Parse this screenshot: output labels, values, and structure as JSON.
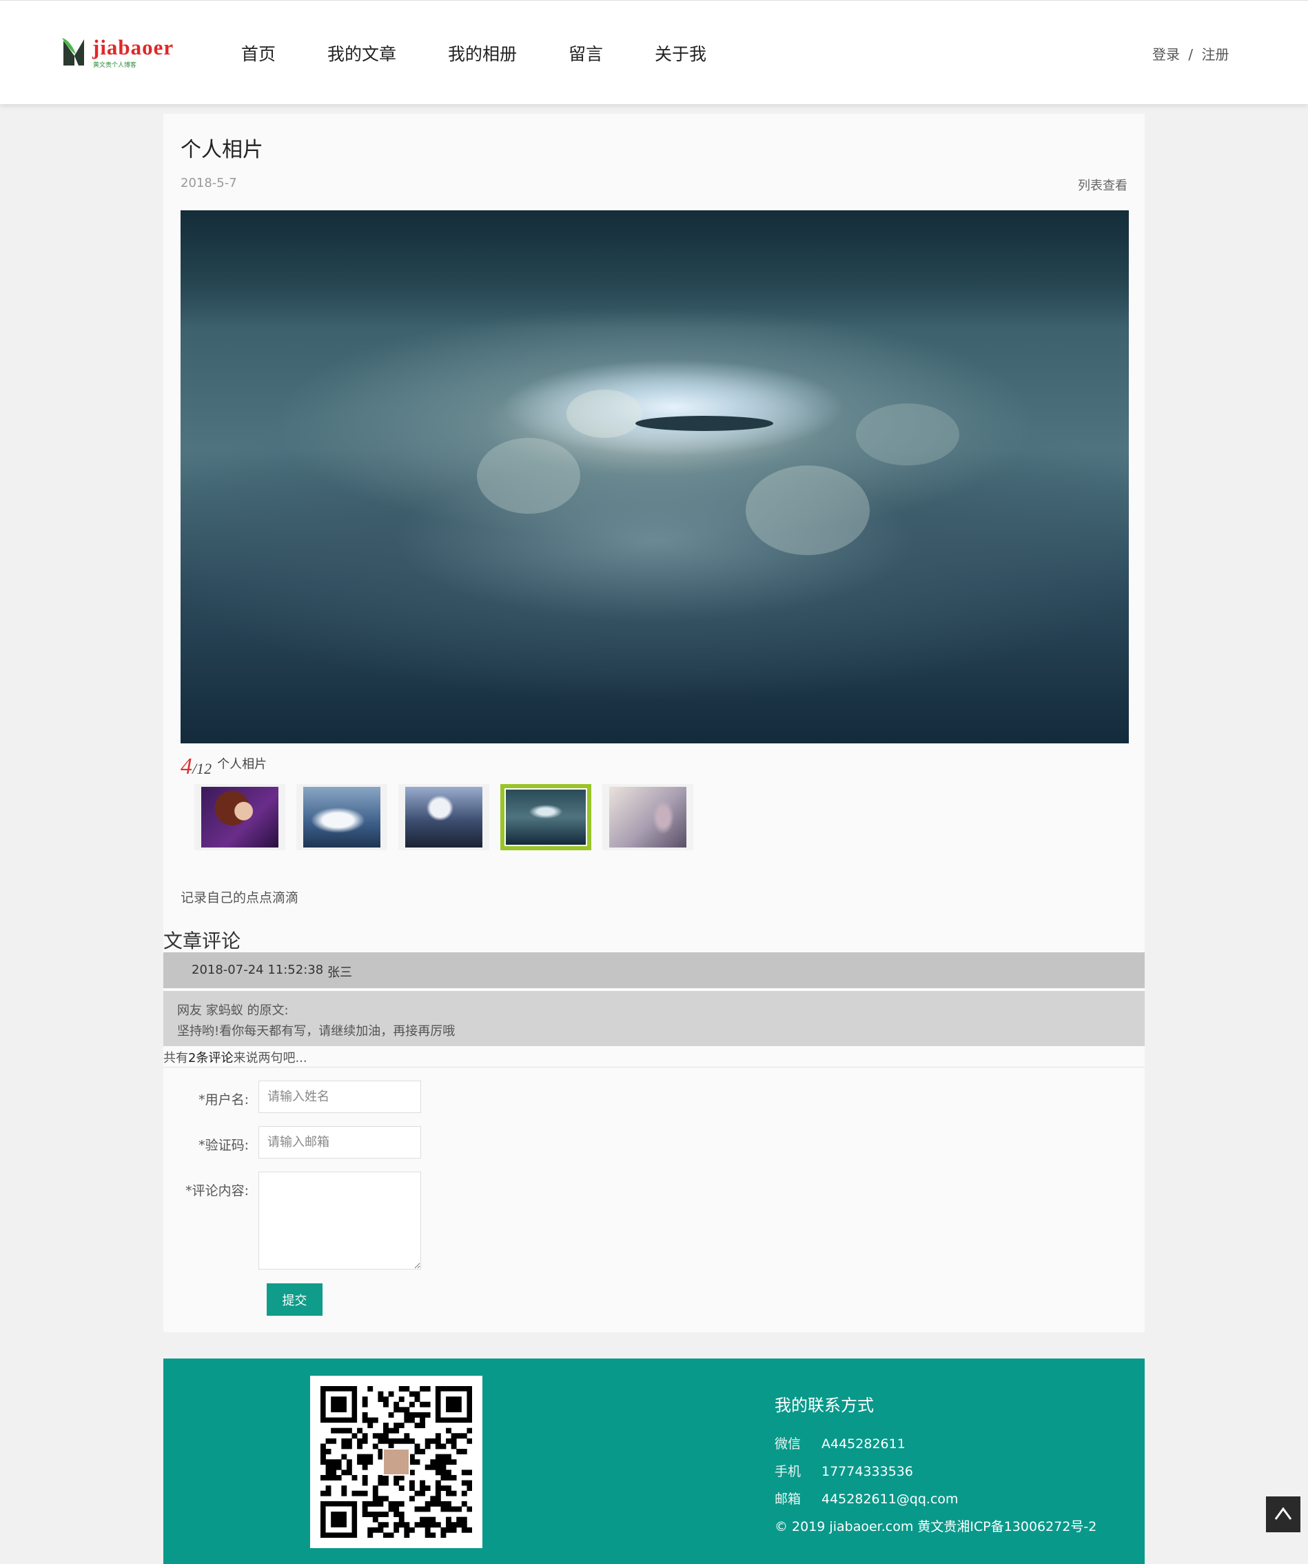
{
  "header": {
    "logo": {
      "brand": "jiabaoer",
      "tagline": "黄文贵个人博客"
    },
    "nav": [
      {
        "label": "首页",
        "icon": ""
      },
      {
        "label": "我的文章",
        "icon": ""
      },
      {
        "label": "我的相册",
        "icon": ""
      },
      {
        "label": "留言",
        "icon": ""
      },
      {
        "label": "关于我",
        "icon": ""
      }
    ],
    "auth": {
      "login": "登录",
      "sep": "/",
      "register": "注册"
    }
  },
  "album": {
    "title": "个人相片",
    "date": "2018-5-7",
    "list_view": "列表查看",
    "counter": {
      "current": "4",
      "total": "/12",
      "album_name": "个人相片"
    },
    "thumbnails": [
      {
        "name": "thumb-woman-purple",
        "active": false
      },
      {
        "name": "thumb-snow-peak",
        "active": false
      },
      {
        "name": "thumb-winged-horse",
        "active": false
      },
      {
        "name": "thumb-clouds",
        "active": true
      },
      {
        "name": "thumb-fantasy-girl",
        "active": false
      }
    ],
    "description": "记录自己的点点滴滴"
  },
  "comments": {
    "section_title": "文章评论",
    "items": [
      {
        "time": "2018-07-24 11:52:38",
        "author": "张三",
        "quote_line": "网友 家蚂蚁 的原文:",
        "content": "坚持哟!看你每天都有写，请继续加油，再接再厉哦"
      }
    ],
    "count_prefix": "共有",
    "count_value": "2条",
    "count_mid": "评论",
    "count_suffix": "来说两句吧..."
  },
  "form": {
    "username_label": "*用户名:",
    "username_placeholder": "请输入姓名",
    "captcha_label": "*验证码:",
    "captcha_placeholder": "请输入邮箱",
    "content_label": "*评论内容:",
    "submit_label": "提交"
  },
  "footer": {
    "contact_title": "我的联系方式",
    "wechat_label": "微信",
    "wechat_value": "A445282611",
    "phone_label": "手机",
    "phone_value": "17774333536",
    "email_label": "邮箱",
    "email_value": "445282611@qq.com",
    "copyright": "© 2019 jiabaoer.com 黄文贵湘ICP备13006272号-2"
  },
  "colors": {
    "accent": "#09998a",
    "active_thumb": "#9ac42a",
    "counter": "#dd3333"
  },
  "icons": {
    "back_to_top": "chevron-up-icon",
    "qr": "qr-code-icon"
  }
}
